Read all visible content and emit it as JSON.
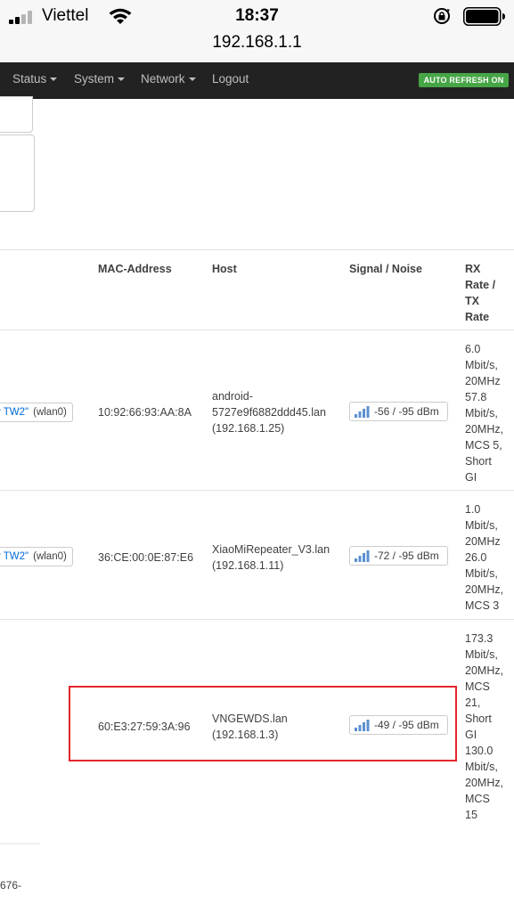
{
  "status_bar": {
    "carrier": "Viettel",
    "time": "18:37",
    "url": "192.168.1.1",
    "icons": [
      "cellular-signal-icon",
      "wifi-icon",
      "rotation-lock-icon",
      "battery-icon"
    ]
  },
  "nav": {
    "status": "Status",
    "system": "System",
    "network": "Network",
    "logout": "Logout",
    "auto_refresh": "AUTO REFRESH ON"
  },
  "table": {
    "headers": {
      "mac": "MAC-Address",
      "host": "Host",
      "signal": "Signal / Noise",
      "rate": [
        "RX",
        "Rate /",
        "TX",
        "Rate"
      ]
    },
    "rows": [
      {
        "ssid": "y TW2\"",
        "iface": "(wlan0)",
        "mac": "10:92:66:93:AA:8A",
        "host": [
          "android-",
          "5727e9f6882ddd45.lan",
          "(192.168.1.25)"
        ],
        "signal": "-56 / -95 dBm",
        "rate": [
          "6.0",
          "Mbit/s,",
          "20MHz",
          "57.8",
          "Mbit/s,",
          "20MHz,",
          "MCS 5,",
          "Short",
          "GI"
        ]
      },
      {
        "ssid": "y TW2\"",
        "iface": "(wlan0)",
        "mac": "36:CE:00:0E:87:E6",
        "host": [
          "XiaoMiRepeater_V3.lan",
          "(192.168.1.11)"
        ],
        "signal": "-72 / -95 dBm",
        "rate": [
          "1.0",
          "Mbit/s,",
          "20MHz",
          "26.0",
          "Mbit/s,",
          "20MHz,",
          "MCS 3"
        ]
      },
      {
        "mac": "60:E3:27:59:3A:96",
        "host": [
          "VNGEWDS.lan",
          "(192.168.1.3)"
        ],
        "signal": "-49 / -95 dBm",
        "rate": [
          "173.3",
          "Mbit/s,",
          "20MHz,",
          "MCS",
          "21,",
          "Short",
          "GI",
          "130.0",
          "Mbit/s,",
          "20MHz,",
          "MCS",
          "15"
        ]
      }
    ]
  },
  "footer_fragment": "676-",
  "colors": {
    "navbar": "#222222",
    "auto_refresh_bg": "#46a546",
    "link": "#0069d6",
    "highlight_border": "#e3262d",
    "signal_bar": "#5b8fd0"
  }
}
